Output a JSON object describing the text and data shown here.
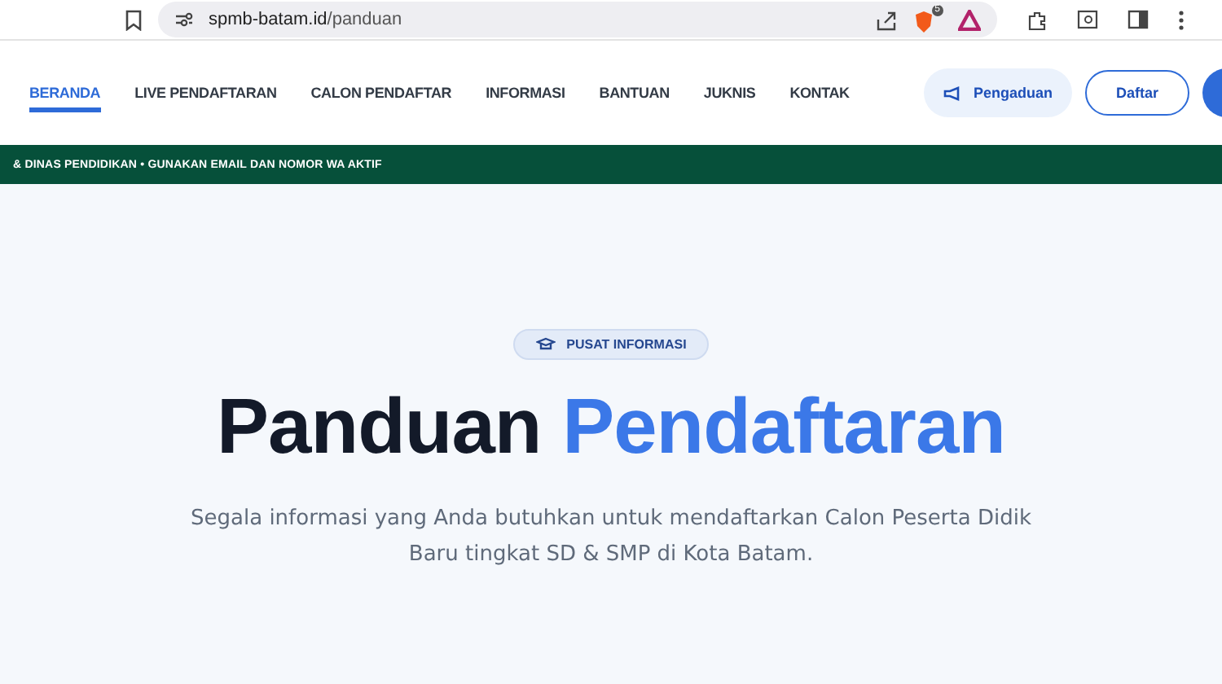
{
  "browser": {
    "url_host": "spmb-batam.id",
    "url_path": "/panduan",
    "shield_badge": "5"
  },
  "nav": {
    "items": [
      {
        "label": "BERANDA",
        "selected": true
      },
      {
        "label": "LIVE PENDAFTARAN",
        "selected": false
      },
      {
        "label": "CALON PENDAFTAR",
        "selected": false
      },
      {
        "label": "INFORMASI",
        "selected": false
      },
      {
        "label": "BANTUAN",
        "selected": false
      },
      {
        "label": "JUKNIS",
        "selected": false
      },
      {
        "label": "KONTAK",
        "selected": false
      }
    ],
    "complaint_button": "Pengaduan",
    "register_button": "Daftar"
  },
  "ticker": "& DINAS PENDIDIKAN • GUNAKAN EMAIL DAN NOMOR WA AKTIF",
  "hero": {
    "badge": "PUSAT INFORMASI",
    "title_start": "Panduan",
    "title_highlight": "Pendaftaran",
    "subtitle": "Segala informasi yang Anda butuhkan untuk mendaftarkan Calon Peserta Didik Baru tingkat SD & SMP di Kota Batam."
  }
}
